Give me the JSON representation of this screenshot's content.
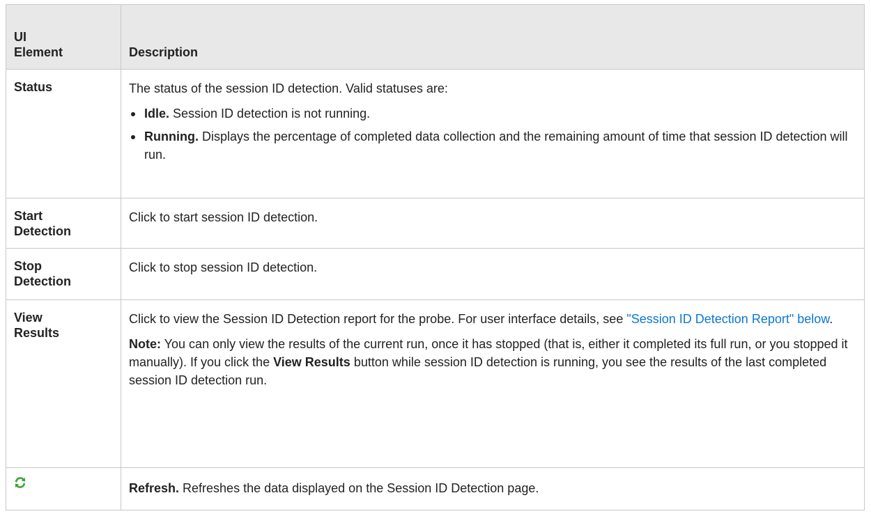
{
  "header": {
    "col1_line1": "UI",
    "col1_line2": "Element",
    "col2": "Description"
  },
  "rows": {
    "status": {
      "element": "Status",
      "intro": "The status of the session ID detection. Valid statuses are:",
      "bullets": [
        {
          "term": "Idle.",
          "text": " Session ID detection is not running."
        },
        {
          "term": "Running.",
          "text": " Displays the percentage of completed data collection and the remaining amount of time that session ID detection will run."
        }
      ]
    },
    "start": {
      "element_line1": "Start",
      "element_line2": "Detection",
      "description": "Click to start session ID detection."
    },
    "stop": {
      "element_line1": "Stop",
      "element_line2": "Detection",
      "description": "Click to stop session ID detection."
    },
    "view": {
      "element_line1": "View",
      "element_line2": "Results",
      "desc_prefix": "Click to view the Session ID Detection report for the probe. For user interface details, see ",
      "link_text": "\"Session ID Detection Report\" below",
      "desc_suffix": ".",
      "note_label": "Note:",
      "note_part1": " You can only view the results of the current run, once it has stopped (that is, either it completed its full run, or you stopped it manually). If you click the ",
      "note_button": "View Results",
      "note_part2": " button while session ID detection is running, you see the results of the last completed session ID detection run."
    },
    "refresh": {
      "icon": "refresh-icon",
      "term": "Refresh.",
      "text": " Refreshes the data displayed on the Session ID Detection page."
    }
  },
  "colors": {
    "header_bg": "#e8e8e8",
    "border": "#c8c8c8",
    "link": "#0a78d2",
    "icon_green": "#3aa63a"
  }
}
